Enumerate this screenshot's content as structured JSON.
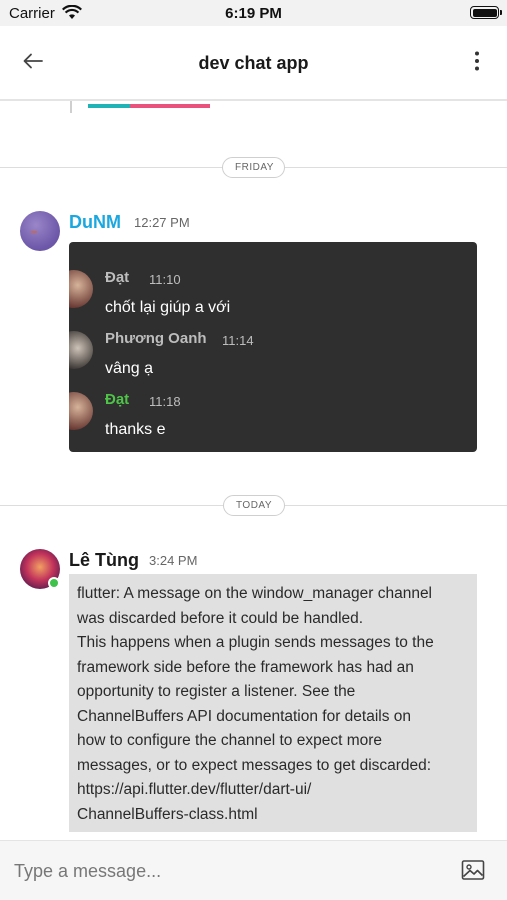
{
  "status_bar": {
    "carrier": "Carrier",
    "time": "6:19 PM"
  },
  "header": {
    "title": "dev chat app",
    "back_icon": "arrow-left-icon",
    "more_icon": "more-vertical-icon"
  },
  "separators": {
    "friday": "FRIDAY",
    "today": "TODAY"
  },
  "messages": [
    {
      "sender": "DuNM",
      "time": "12:27 PM",
      "sender_color": "#1ba7e0",
      "forwarded": [
        {
          "name": "Đạt",
          "time": "11:10",
          "text": "chốt lại giúp a với"
        },
        {
          "name": "Phương Oanh",
          "time": "11:14",
          "text": "vâng ạ"
        },
        {
          "name": "Đạt",
          "time": "11:18",
          "text": "thanks e",
          "name_color": "#4fc449"
        }
      ]
    },
    {
      "sender": "Lê Tùng",
      "time": "3:24 PM",
      "online": true,
      "text": "flutter: A message on the window_manager channel\nwas discarded before it could be handled.\nThis happens when a plugin sends messages to the\nframework side before the framework has had an\nopportunity to register a listener. See the\nChannelBuffers API documentation for details on\nhow to configure the channel to expect more\nmessages, or to expect messages to get discarded:\n  https://api.flutter.dev/flutter/dart-ui/\nChannelBuffers-class.html"
    }
  ],
  "composer": {
    "placeholder": "Type a message...",
    "image_icon": "image-icon"
  },
  "colors": {
    "accent": "#1ba7e0",
    "card_dark": "#2f2f2f",
    "online": "#3fc24a",
    "bubble": "#e0e0e0"
  }
}
